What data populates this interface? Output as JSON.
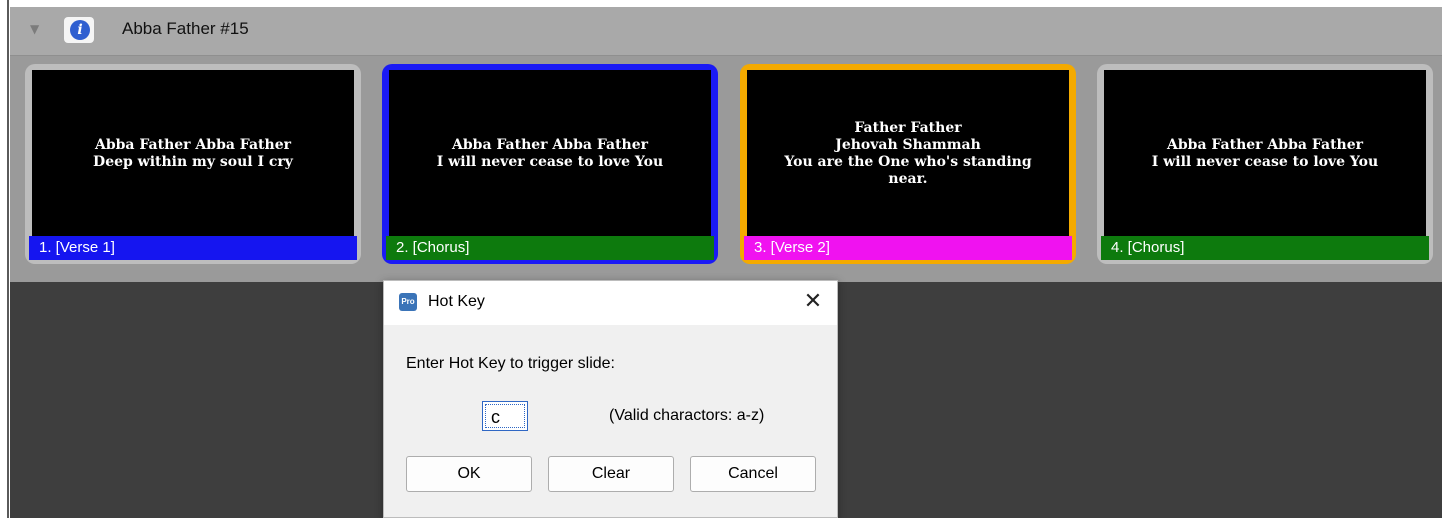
{
  "header": {
    "collapse_icon": "triangle-down-icon",
    "info_icon": "info-icon",
    "title": "Abba Father #15"
  },
  "slides": [
    {
      "text": "Abba Father Abba Father\nDeep within my soul I cry",
      "label": "1.  [Verse 1]",
      "label_color": "#1515f0",
      "border": "#bdbdbd",
      "selected": false
    },
    {
      "text": "Abba Father Abba Father\nI will never cease to love You",
      "label": "2.  [Chorus]",
      "label_color": "#0d7a0d",
      "border": "#1a1af5",
      "selected": true
    },
    {
      "text": "Father Father\nJehovah Shammah\nYou are the One who's standing\nnear.",
      "label": "3.  [Verse 2]",
      "label_color": "#f012f0",
      "border": "#f4aa00",
      "selected": false
    },
    {
      "text": "Abba Father Abba Father\nI will never cease to love You",
      "label": "4.  [Chorus]",
      "label_color": "#0d7a0d",
      "border": "#bdbdbd",
      "selected": false
    }
  ],
  "dialog": {
    "app_icon_text": "Pro",
    "title": "Hot Key",
    "close_icon": "close-icon",
    "close_glyph": "✕",
    "prompt": "Enter Hot Key to trigger slide:",
    "input_value": "c",
    "valid_text": "(Valid charactors: a-z)",
    "ok_label": "OK",
    "clear_label": "Clear",
    "cancel_label": "Cancel"
  }
}
